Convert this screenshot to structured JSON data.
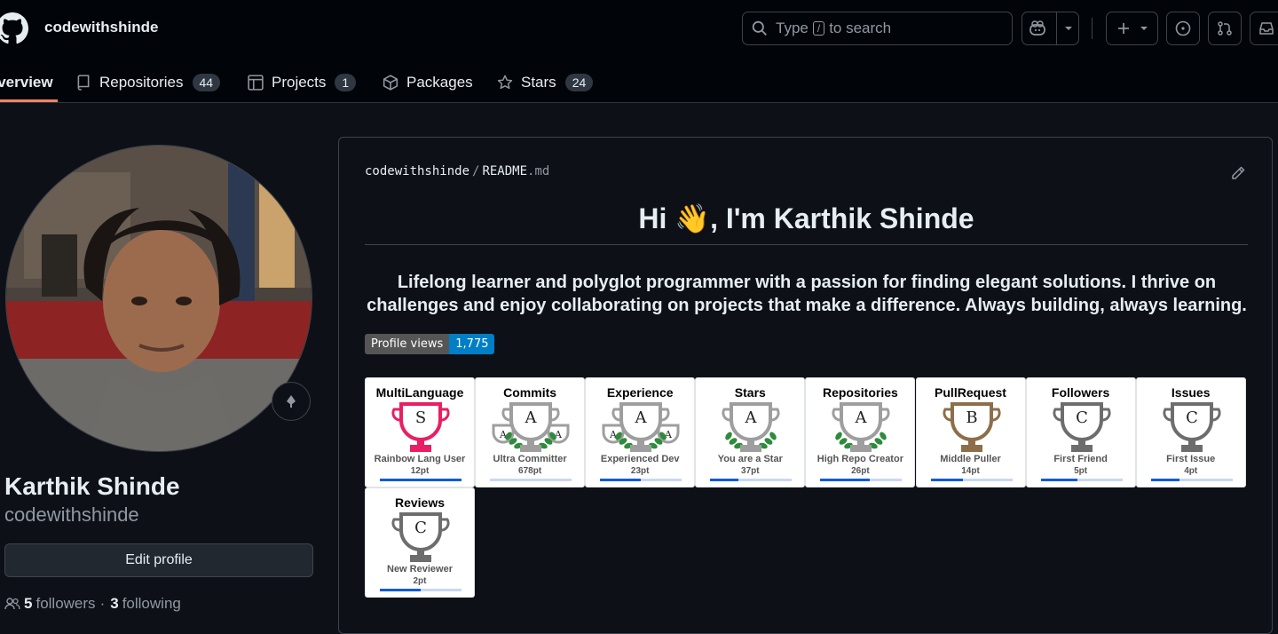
{
  "header": {
    "username": "codewithshinde",
    "search": {
      "prefix": "Type",
      "key": "/",
      "suffix": "to search"
    }
  },
  "tabs": [
    {
      "label": "Overview",
      "count": null
    },
    {
      "label": "Repositories",
      "count": "44"
    },
    {
      "label": "Projects",
      "count": "1"
    },
    {
      "label": "Packages",
      "count": null
    },
    {
      "label": "Stars",
      "count": "24"
    }
  ],
  "profile": {
    "full_name": "Karthik Shinde",
    "login": "codewithshinde",
    "edit_label": "Edit profile",
    "followers_count": "5",
    "followers_label": "followers",
    "dot": "·",
    "following_count": "3",
    "following_label": "following"
  },
  "readme": {
    "breadcrumb_owner": "codewithshinde",
    "breadcrumb_sep": "/",
    "breadcrumb_file": "README",
    "breadcrumb_ext": ".md",
    "heading": "Hi 👋, I'm Karthik Shinde",
    "intro": "Lifelong learner and polyglot programmer with a passion for finding elegant solutions. I thrive on challenges and enjoy collaborating on projects that make a difference. Always building, always learning.",
    "views_label": "Profile views",
    "views_count": "1,775"
  },
  "trophies": [
    {
      "title": "MultiLanguage",
      "rank": "S",
      "name": "Rainbow Lang User",
      "points": "12pt",
      "progress": 1.0
    },
    {
      "title": "Commits",
      "rank": "A",
      "name": "Ultra Committer",
      "points": "678pt",
      "progress": 0.0
    },
    {
      "title": "Experience",
      "rank": "A",
      "name": "Experienced Dev",
      "points": "23pt",
      "progress": 0.5
    },
    {
      "title": "Stars",
      "rank": "A",
      "name": "You are a Star",
      "points": "37pt",
      "progress": 0.35
    },
    {
      "title": "Repositories",
      "rank": "A",
      "name": "High Repo Creator",
      "points": "26pt",
      "progress": 0.6
    },
    {
      "title": "PullRequest",
      "rank": "B",
      "name": "Middle Puller",
      "points": "14pt",
      "progress": 0.4
    },
    {
      "title": "Followers",
      "rank": "C",
      "name": "First Friend",
      "points": "5pt",
      "progress": 0.45
    },
    {
      "title": "Issues",
      "rank": "C",
      "name": "First Issue",
      "points": "4pt",
      "progress": 0.35
    },
    {
      "title": "Reviews",
      "rank": "C",
      "name": "New Reviewer",
      "points": "2pt",
      "progress": 0.5
    }
  ],
  "colors": {
    "accent": "#f78166",
    "rank_s": "#e91e63",
    "rank_a": "#9e9e9e",
    "rank_b": "#8d6e4a",
    "rank_c": "#6d6d6d"
  }
}
